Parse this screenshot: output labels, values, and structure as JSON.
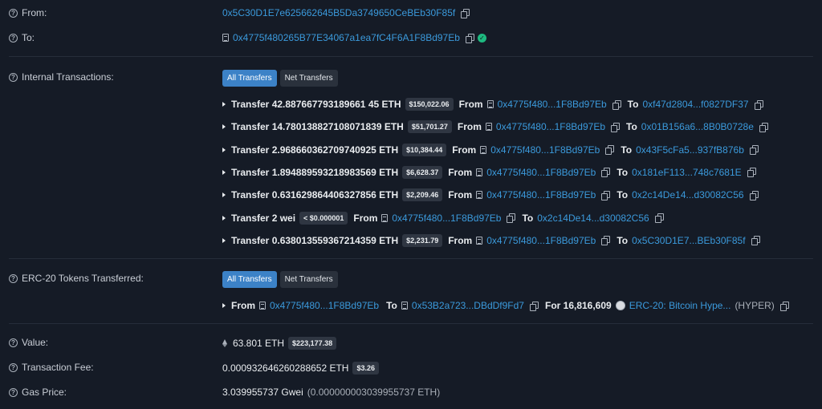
{
  "from": {
    "label": "From:",
    "address": "0x5C30D1E7e625662645B5Da3749650CeBEb30F85f"
  },
  "to": {
    "label": "To:",
    "address": "0x4775f480265B77E34067a1ea7fC4F6A1F8Bd97Eb"
  },
  "internal": {
    "label": "Internal Transactions:",
    "tabs": [
      "All Transfers",
      "Net Transfers"
    ],
    "transfers": [
      {
        "amount": "Transfer 42.887667793189661 45 ETH",
        "usd": "$150,022.06",
        "from": "0x4775f480...1F8Bd97Eb",
        "to": "0xf47d2804...f0827DF37"
      },
      {
        "amount": "Transfer 14.780138827108071839 ETH",
        "usd": "$51,701.27",
        "from": "0x4775f480...1F8Bd97Eb",
        "to": "0x01B156a6...8B0B0728e"
      },
      {
        "amount": "Transfer 2.968660362709740925 ETH",
        "usd": "$10,384.44",
        "from": "0x4775f480...1F8Bd97Eb",
        "to": "0x43F5cFa5...937fB876b"
      },
      {
        "amount": "Transfer 1.894889593218983569 ETH",
        "usd": "$6,628.37",
        "from": "0x4775f480...1F8Bd97Eb",
        "to": "0x181eF113...748c7681E"
      },
      {
        "amount": "Transfer 0.631629864406327856 ETH",
        "usd": "$2,209.46",
        "from": "0x4775f480...1F8Bd97Eb",
        "to": "0x2c14De14...d30082C56"
      },
      {
        "amount": "Transfer 2 wei",
        "usd": "< $0.000001",
        "from": "0x4775f480...1F8Bd97Eb",
        "to": "0x2c14De14...d30082C56"
      },
      {
        "amount": "Transfer 0.638013559367214359 ETH",
        "usd": "$2,231.79",
        "from": "0x4775f480...1F8Bd97Eb",
        "to": "0x5C30D1E7...BEb30F85f"
      }
    ],
    "from_word": "From",
    "to_word": "To"
  },
  "erc20": {
    "label": "ERC-20 Tokens Transferred:",
    "tabs": [
      "All Transfers",
      "Net Transfers"
    ],
    "from_word": "From",
    "from": "0x4775f480...1F8Bd97Eb",
    "to_word": "To",
    "to": "0x53B2a723...DBdDf9Fd7",
    "for_text": "For 16,816,609",
    "token": "ERC-20: Bitcoin Hype...",
    "symbol": "(HYPER)"
  },
  "value": {
    "label": "Value:",
    "amount": "63.801 ETH",
    "usd": "$223,177.38"
  },
  "fee": {
    "label": "Transaction Fee:",
    "amount": "0.000932646260288652 ETH",
    "usd": "$3.26"
  },
  "gas": {
    "label": "Gas Price:",
    "amount": "3.039955737 Gwei",
    "eth": "(0.000000003039955737 ETH)"
  },
  "colors": {
    "background": "#151b26",
    "link": "#3b9adc",
    "accent": "#3c82c7",
    "success": "#1eb980"
  }
}
